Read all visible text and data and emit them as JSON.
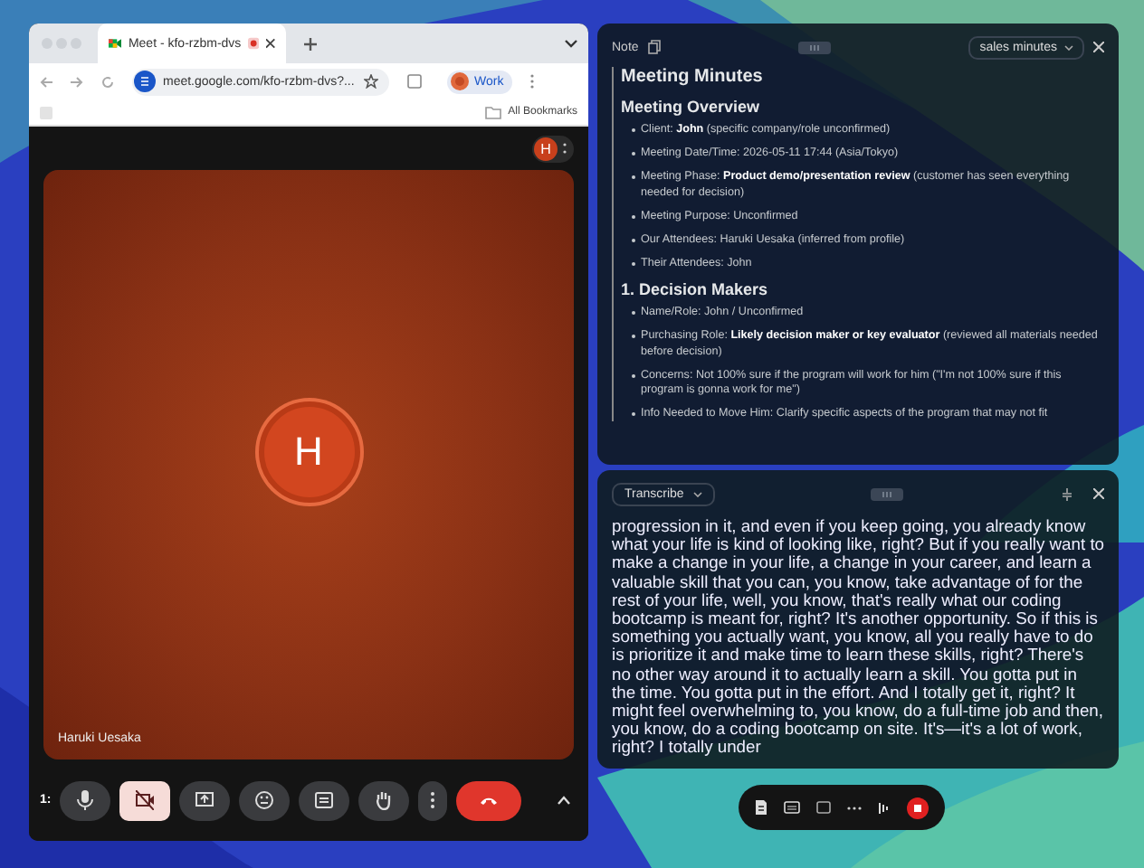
{
  "browser": {
    "tabs": [
      {
        "title": "Meet - kfo-rzbm-dvs",
        "selected": true,
        "recording": true
      }
    ],
    "url": "meet.google.com/kfo-rzbm-dvs?...",
    "profile": "Work",
    "bookmarks": "All Bookmarks"
  },
  "meet": {
    "self_avatar": "H",
    "participant": {
      "initial": "H",
      "name": "Haruki Uesaka"
    },
    "time": "1:",
    "controls": [
      {
        "kind": "mic",
        "highlighted": false
      },
      {
        "kind": "camera",
        "highlighted": true
      },
      {
        "kind": "present",
        "highlighted": false
      },
      {
        "kind": "emoji",
        "highlighted": false
      },
      {
        "kind": "captions",
        "highlighted": false
      },
      {
        "kind": "hand",
        "highlighted": false
      },
      {
        "kind": "more",
        "highlighted": false
      },
      {
        "kind": "leave",
        "highlighted": false
      }
    ]
  },
  "note": {
    "title": "Note",
    "template": "sales minutes",
    "blocks": [
      {
        "kind": "h1",
        "text": "Meeting Minutes"
      },
      {
        "kind": "h2",
        "text": "Meeting Overview"
      },
      {
        "kind": "bullet",
        "text": "Client: **John** (specific company/role unconfirmed)"
      },
      {
        "kind": "bullet",
        "text": "Meeting Date/Time: 2026-05-11 17:44 (Asia/Tokyo)"
      },
      {
        "kind": "bullet",
        "text": "Meeting Phase: **Product demo/presentation review** (customer has seen everything needed for decision)"
      },
      {
        "kind": "bullet",
        "text": "Meeting Purpose: Unconfirmed"
      },
      {
        "kind": "bullet",
        "text": "Our Attendees: Haruki Uesaka (inferred from profile)"
      },
      {
        "kind": "bullet",
        "text": "Their Attendees: John"
      },
      {
        "kind": "h2",
        "text": "1. Decision Makers"
      },
      {
        "kind": "bullet",
        "text": "Name/Role: John / Unconfirmed"
      },
      {
        "kind": "bullet",
        "text": "Purchasing Role: **Likely decision maker or key evaluator** (reviewed all materials needed before decision)"
      },
      {
        "kind": "bullet",
        "text": "Concerns: Not 100% sure if the program will work for him (\"I'm not 100% sure if this program is gonna work for me\")"
      },
      {
        "kind": "bullet",
        "text": "Info Needed to Move Him: Clarify specific aspects of the program that may not fit"
      }
    ]
  },
  "transcribe": {
    "mode": "Transcribe",
    "text": "progression in it, and even if you keep going, you already know what your life is kind of looking like, right? But if you really want to make a change in your life, a change in your career, and learn a valuable skill that you can, you know, take advantage of for the rest of your life, well, you know, that's really what our coding bootcamp is meant for, right? It's another opportunity. So if this is something you actually want, you know, all you really have to do is prioritize it and make time to learn these skills, right? There's no other way around it to actually learn a skill. You gotta put in the time. You gotta put in the effort. And I totally get it, right? It might feel overwhelming to, you know, do a full-time job and then, you know, do a coding bootcamp on site. It's—it's a lot of work, right? I totally under"
  }
}
